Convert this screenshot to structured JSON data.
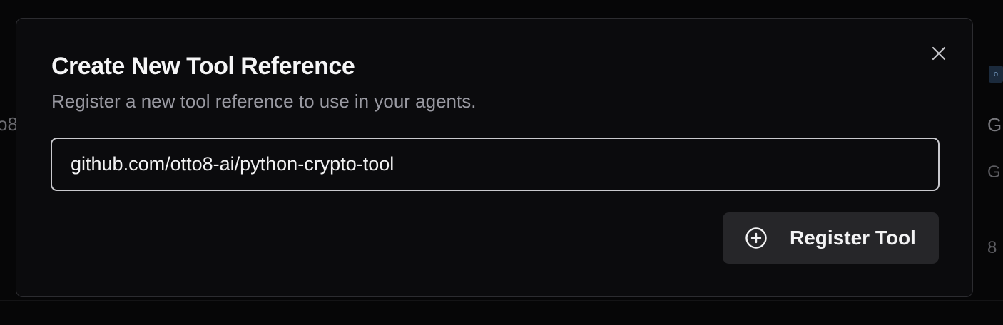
{
  "background": {
    "partial_left_text": "o8",
    "partial_right_texts": [
      "G",
      "G",
      "8"
    ],
    "partial_chip_text": "o"
  },
  "dialog": {
    "title": "Create New Tool Reference",
    "subtitle": "Register a new tool reference to use in your agents.",
    "input_value": "github.com/otto8-ai/python-crypto-tool",
    "submit_label": "Register Tool",
    "close_icon": "close-icon",
    "submit_icon": "plus-circle-icon"
  },
  "colors": {
    "modal_background": "#0b0b0d",
    "button_background": "#262629",
    "input_border": "#c9c9cd"
  }
}
